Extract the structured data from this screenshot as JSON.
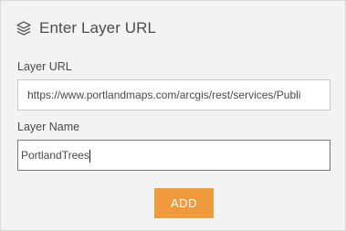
{
  "header": {
    "icon": "layers-icon",
    "title": "Enter Layer URL"
  },
  "form": {
    "url_label": "Layer URL",
    "url_value": "https://www.portlandmaps.com/arcgis/rest/services/Publi",
    "name_label": "Layer Name",
    "name_value": "PortlandTrees",
    "add_label": "ADD"
  },
  "colors": {
    "accent": "#ef9a3d",
    "panel_bg": "#f3f3f3"
  }
}
